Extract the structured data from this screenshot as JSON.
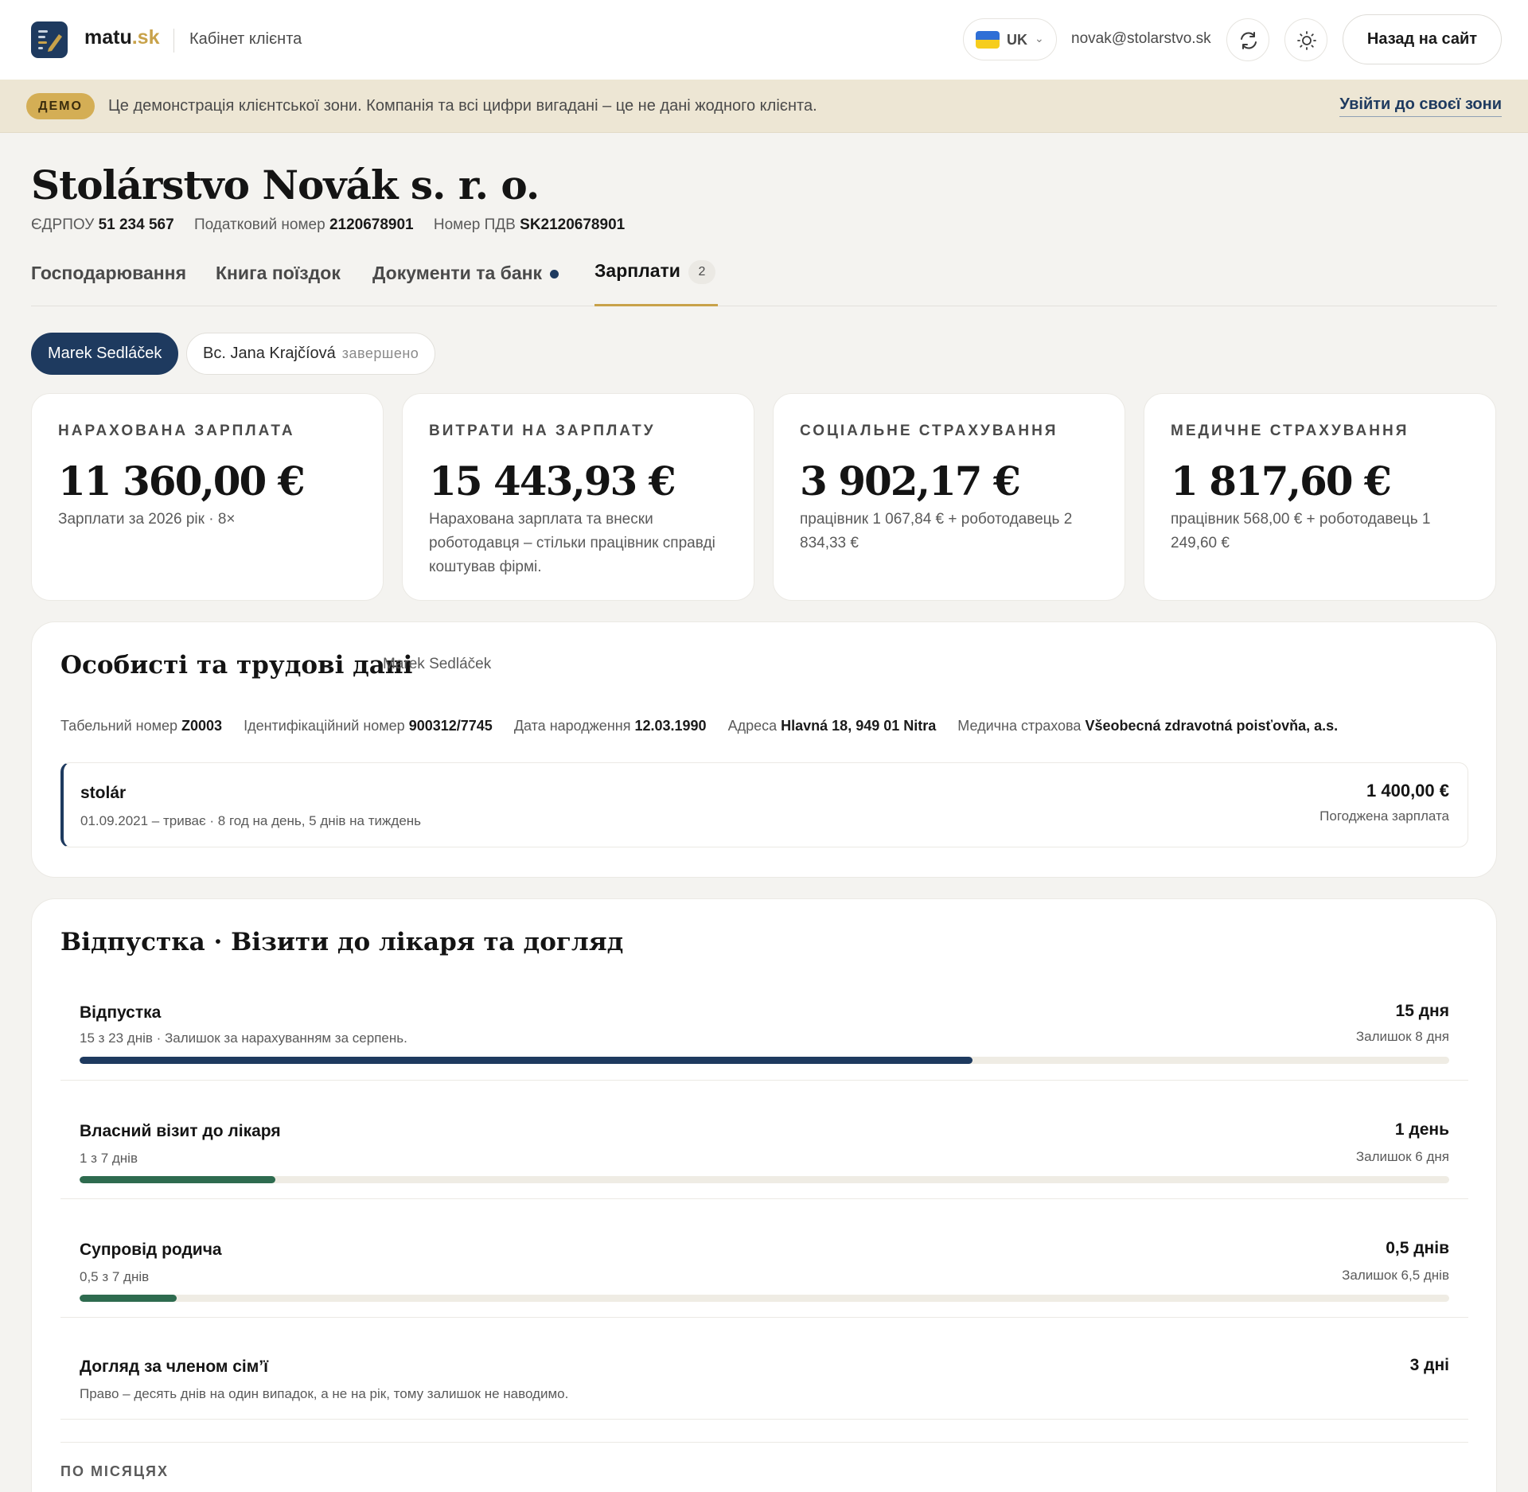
{
  "header": {
    "brand_main": "matu",
    "brand_accent": ".sk",
    "cabinet": "Кабінет клієнта",
    "lang_code": "UK",
    "email": "novak@stolarstvo.sk",
    "back_label": "Назад на сайт",
    "icons": [
      "logo-icon",
      "flag-ua-icon",
      "chevron-down-icon",
      "refresh-icon",
      "sun-icon"
    ]
  },
  "demo": {
    "badge": "ДЕМО",
    "text": "Це демонстрація клієнтської зони. Компанія та всі цифри вигадані – це не дані жодного клієнта.",
    "link": "Увійти до своєї зони"
  },
  "company": {
    "name": "Stolárstvo Novák s. r. o.",
    "ids": [
      {
        "label": "ЄДРПОУ",
        "value": "51 234 567"
      },
      {
        "label": "Податковий номер",
        "value": "2120678901"
      },
      {
        "label": "Номер ПДВ",
        "value": "SK2120678901"
      }
    ]
  },
  "tabs": [
    {
      "label": "Господарювання"
    },
    {
      "label": "Книга поїздок"
    },
    {
      "label": "Документи та банк"
    },
    {
      "label": "Зарплати",
      "count": "2"
    }
  ],
  "employees": [
    {
      "name": "Marek Sedláček"
    },
    {
      "name": "Bc. Jana Krajčíová",
      "status": "завершено"
    }
  ],
  "stats": [
    {
      "label": "НАРАХОВАНА ЗАРПЛАТА",
      "value": "11 360,00 €",
      "note": "Зарплати за 2026 рік · 8×"
    },
    {
      "label": "ВИТРАТИ НА ЗАРПЛАТУ",
      "value": "15 443,93 €",
      "note": "Нарахована зарплата та внески роботодавця – стільки працівник справді коштував фірмі."
    },
    {
      "label": "СОЦІАЛЬНЕ СТРАХУВАННЯ",
      "value": "3 902,17 €",
      "note": "працівник 1 067,84 € + роботодавець 2 834,33 €"
    },
    {
      "label": "МЕДИЧНЕ СТРАХУВАННЯ",
      "value": "1 817,60 €",
      "note": "працівник 568,00 € + роботодавець 1 249,60 €"
    }
  ],
  "personal": {
    "title": "Особисті та трудові дані",
    "employee": "Marek Sedláček",
    "fields": [
      {
        "label": "Табельний номер",
        "value": "Z0003"
      },
      {
        "label": "Ідентифікаційний номер",
        "value": "900312/7745"
      },
      {
        "label": "Дата народження",
        "value": "12.03.1990"
      },
      {
        "label": "Адреса",
        "value": "Hlavná 18, 949 01 Nitra"
      },
      {
        "label": "Медична страхова",
        "value": "Všeobecná zdravotná poisťovňa, a.s."
      }
    ],
    "job": {
      "position": "stolár",
      "period": "01.09.2021 – триває · 8 год на день, 5 днів на тиждень",
      "salary": "1 400,00 €",
      "salary_label": "Погоджена зарплата"
    }
  },
  "leave": {
    "title": "Відпустка · Візити до лікаря та догляд",
    "items": [
      {
        "name": "Відпустка",
        "sub": "15 з 23 днів · Залишок за нарахуванням за серпень.",
        "value": "15 дня",
        "remaining": "Залишок 8 дня",
        "progress": 0.652,
        "color": "#1e3a5f"
      },
      {
        "name": "Власний візит до лікаря",
        "sub": "1 з 7 днів",
        "value": "1 день",
        "remaining": "Залишок 6 дня",
        "progress": 0.143,
        "color": "#2e6b4f"
      },
      {
        "name": "Супровід родича",
        "sub": "0,5 з 7 днів",
        "value": "0,5 днів",
        "remaining": "Залишок 6,5 днів",
        "progress": 0.071,
        "color": "#2e6b4f"
      },
      {
        "name": "Догляд за членом сім’ї",
        "sub": "Право – десять днів на один випадок, а не на рік, тому залишок не наводимо.",
        "value": "3 дні"
      }
    ],
    "monthly_label": "ПО МІСЯЦЯХ"
  }
}
